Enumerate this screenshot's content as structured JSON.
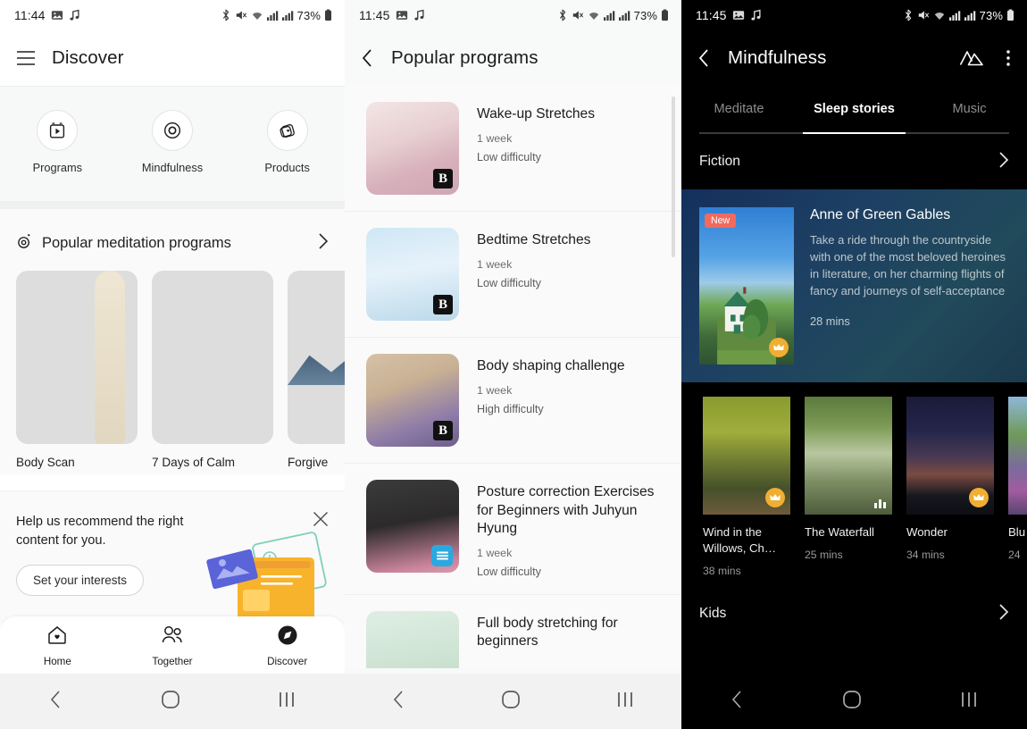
{
  "panel1": {
    "status": {
      "clock": "11:44",
      "battery": "73%",
      "icons": [
        "image-icon",
        "music-note-icon",
        "bluetooth-icon",
        "mute-icon",
        "wifi-icon",
        "signal-icon",
        "signal-icon"
      ]
    },
    "appbar": {
      "title": "Discover",
      "menu_icon": "hamburger-menu-icon"
    },
    "quicknav": [
      {
        "label": "Programs",
        "icon": "video-program-icon"
      },
      {
        "label": "Mindfulness",
        "icon": "circle-target-icon"
      },
      {
        "label": "Products",
        "icon": "products-heart-icon"
      }
    ],
    "section": {
      "title": "Popular meditation programs",
      "icon": "target-heart-icon",
      "chevron": "chevron-right-icon"
    },
    "cards": [
      {
        "caption": "Body Scan"
      },
      {
        "caption": "7 Days of Calm"
      },
      {
        "caption": "Forgive"
      }
    ],
    "banner": {
      "text": "Help us recommend the right content for you.",
      "button": "Set your interests",
      "close_icon": "close-icon"
    },
    "bottomnav": [
      {
        "label": "Home",
        "icon": "home-heart-icon",
        "active": false
      },
      {
        "label": "Together",
        "icon": "people-icon",
        "active": false
      },
      {
        "label": "Discover",
        "icon": "compass-icon",
        "active": true
      }
    ],
    "navbar": [
      "back-icon",
      "home-circle-icon",
      "recents-icon"
    ]
  },
  "panel2": {
    "status": {
      "clock": "11:45",
      "battery": "73%"
    },
    "appbar": {
      "title": "Popular programs",
      "back_icon": "chevron-left-icon"
    },
    "programs": [
      {
        "title": "Wake-up Stretches",
        "duration": "1 week",
        "difficulty": "Low difficulty",
        "badge": "B"
      },
      {
        "title": "Bedtime Stretches",
        "duration": "1 week",
        "difficulty": "Low difficulty",
        "badge": "B"
      },
      {
        "title": "Body shaping challenge",
        "duration": "1 week",
        "difficulty": "High difficulty",
        "badge": "B"
      },
      {
        "title": "Posture correction Exercises for Beginners with Juhyun Hyung",
        "duration": "1 week",
        "difficulty": "Low difficulty",
        "badge": "subtitle-icon"
      },
      {
        "title": "Full body stretching for beginners",
        "duration": "",
        "difficulty": "",
        "badge": ""
      }
    ],
    "navbar": [
      "back-icon",
      "home-circle-icon",
      "recents-icon"
    ]
  },
  "panel3": {
    "status": {
      "clock": "11:45",
      "battery": "73%"
    },
    "appbar": {
      "title": "Mindfulness",
      "back_icon": "chevron-left-icon",
      "mountain_icon": "mountain-icon",
      "more_icon": "more-vertical-icon"
    },
    "tabs": [
      {
        "label": "Meditate",
        "active": false
      },
      {
        "label": "Sleep stories",
        "active": true
      },
      {
        "label": "Music",
        "active": false
      }
    ],
    "sections": [
      {
        "label": "Fiction",
        "chevron": "chevron-right-icon"
      },
      {
        "label": "Kids",
        "chevron": "chevron-right-icon"
      }
    ],
    "feature": {
      "badge": "New",
      "title": "Anne of Green Gables",
      "description": "Take a ride through the countryside with one of the most beloved heroines in literature, on her charming flights of fancy and journeys of self-acceptance",
      "duration": "28 mins",
      "premium_icon": "crown-icon"
    },
    "stories": [
      {
        "title": "Wind in the Willows, Ch…",
        "duration": "38 mins",
        "badge": "crown-icon"
      },
      {
        "title": "The Waterfall",
        "duration": "25 mins",
        "badge": "equalizer-icon"
      },
      {
        "title": "Wonder",
        "duration": "34 mins",
        "badge": "crown-icon"
      },
      {
        "title": "Blu",
        "duration": "24",
        "badge": ""
      }
    ],
    "navbar": [
      "back-icon",
      "home-circle-icon",
      "recents-icon"
    ]
  },
  "colors": {
    "accent_red": "#f2695e",
    "crown_gold": "#f0ae33",
    "blue_badge": "#2aa9e0",
    "dark_bg": "#000000",
    "light_bg": "#fafafa"
  }
}
